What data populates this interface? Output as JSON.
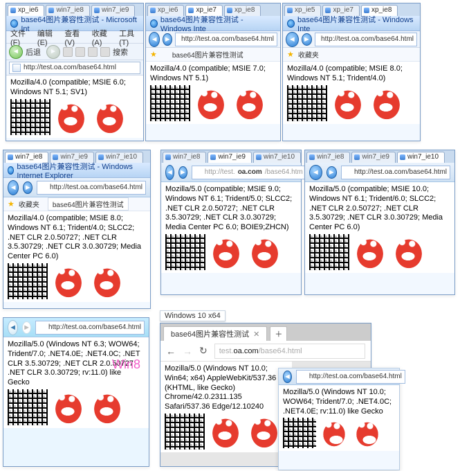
{
  "page_title_suffix": "base64图片兼容性测试",
  "fav_label": "收藏夹",
  "ie6": {
    "fstabs": [
      "xp_ie6",
      "win7_ie8",
      "win7_ie9"
    ],
    "active_tab": 0,
    "title": "base64图片兼容性测试 - Microsoft Int",
    "menu": [
      "文件(F)",
      "编辑(E)",
      "查看(V)",
      "收藏(A)",
      "工具(T)"
    ],
    "back_label": "后退",
    "search_label": "搜索",
    "url": "http://test.oa.com/base64.html",
    "ua": "Mozilla/4.0 (compatible; MSIE 6.0; Windows NT 5.1; SV1)"
  },
  "ie7": {
    "fstabs": [
      "xp_ie6",
      "xp_ie7",
      "xp_ie8"
    ],
    "active_tab": 1,
    "title": "base64图片兼容性测试 - Windows Inte",
    "url": "http://test.oa.com/base64.html",
    "tab_label": "base64图片兼容性测试",
    "ua": "Mozilla/4.0 (compatible; MSIE 7.0; Windows NT 5.1)"
  },
  "ie8xp": {
    "fstabs": [
      "xp_ie5",
      "xp_ie7",
      "xp_ie8"
    ],
    "active_tab": 2,
    "title": "base64图片兼容性测试 - Windows Inte",
    "url": "http://test.oa.com/base64.html",
    "fav": "收藏夹",
    "ua": "Mozilla/4.0 (compatible; MSIE 8.0; Windows NT 5.1; Trident/4.0)"
  },
  "ie8win7": {
    "fstabs": [
      "win7_ie8",
      "win7_ie9",
      "win7_ie10"
    ],
    "active_tab": 0,
    "title": "base64图片兼容性测试 - Windows Internet Explorer",
    "url": "http://test.oa.com/base64.html",
    "fav": "收藏夹",
    "tab_label": "base64图片兼容性测试",
    "ua": "Mozilla/4.0 (compatible; MSIE 8.0; Windows NT 6.1; Trident/4.0; SLCC2; .NET CLR 2.0.50727; .NET CLR 3.5.30729; .NET CLR 3.0.30729; Media Center PC 6.0)"
  },
  "ie9": {
    "fstabs": [
      "win7_ie8",
      "win7_ie9",
      "win7_ie10"
    ],
    "active_tab": 1,
    "url_pre": "http://test.",
    "url_strong": "oa.com",
    "url_post": "/base64.htm",
    "ua": "Mozilla/5.0 (compatible; MSIE 9.0; Windows NT 6.1; Trident/5.0; SLCC2; .NET CLR 2.0.50727; .NET CLR 3.5.30729; .NET CLR 3.0.30729; Media Center PC 6.0; BOIE9;ZHCN)"
  },
  "ie10": {
    "fstabs": [
      "win7_ie8",
      "win7_ie9",
      "win7_ie10"
    ],
    "active_tab": 2,
    "url": "http://test.oa.com/base64.html",
    "ua": "Mozilla/5.0 (compatible; MSIE 10.0; Windows NT 6.1; Trident/6.0; SLCC2; .NET CLR 2.0.50727; .NET CLR 3.5.30729; .NET CLR 3.0.30729; Media Center PC 6.0)"
  },
  "ie11": {
    "url": "http://test.oa.com/base64.html",
    "label": "Win8",
    "ua": "Mozilla/5.0 (Windows NT 6.3; WOW64; Trident/7.0; .NET4.0E; .NET4.0C; .NET CLR 3.5.30729; .NET CLR 2.0.50727; .NET CLR 3.0.30729; rv:11.0) like Gecko"
  },
  "edge": {
    "os_badge": "Windows 10 x64",
    "tab_label": "base64图片兼容性测试",
    "url_pre": "test.",
    "url_strong": "oa.com",
    "url_post": "/base64.html",
    "ua": "Mozilla/5.0 (Windows NT 10.0; Win64; x64) AppleWebKit/537.36 (KHTML, like Gecko) Chrome/42.0.2311.135 Safari/537.36 Edge/12.10240"
  },
  "ie11w10": {
    "url": "http://test.oa.com/base64.html",
    "ua": "Mozilla/5.0 (Windows NT 10.0; WOW64; Trident/7.0; .NET4.0C; .NET4.0E; rv:11.0) like Gecko"
  }
}
